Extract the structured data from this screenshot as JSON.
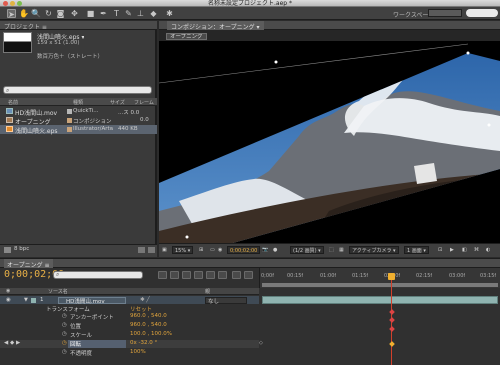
{
  "window": {
    "title": "名称未設定プロジェクト.aep *"
  },
  "toolbar": {
    "workspace_label": "ワークスペース："
  },
  "project_panel": {
    "tab_label": "プロジェクト ≡",
    "selected_item": {
      "name": "浅間山噴火.eps ▾",
      "dimensions": "159 x 51 (1.00)",
      "info": "数百万色＋（ストレート）"
    },
    "search_placeholder": "",
    "columns": [
      "名前",
      "種類",
      "サイズ",
      "フレーム"
    ],
    "items": [
      {
        "name": "HD浅間山.mov",
        "type": "QuickTi...",
        "size": "...ス 0.0"
      },
      {
        "name": "オープニング",
        "type": "コンポジション",
        "size": "0.0"
      },
      {
        "name": "浅間山噴火.eps",
        "type": "Illustrator/Artwork",
        "size": "440 KB"
      }
    ],
    "footer_bpc": "8 bpc"
  },
  "comp_panel": {
    "tab_label": "コンポジション：オープニング ▾",
    "subtab": "オープニング",
    "zoom": "15% ▾",
    "timecode": "0;00;02;00",
    "resolution": "(1/2 画質) ▾",
    "camera": "アクティブカメラ ▾",
    "views": "1 画面 ▾",
    "colors": {
      "viewer_bg": "#000000",
      "sky": "#2f6fb3"
    }
  },
  "timeline": {
    "tab_label": "オープニング ≡",
    "timecode": "0;00;02;00",
    "search_placeholder": "",
    "ruler_ticks": [
      "0;00f",
      "00:15f",
      "01:00f",
      "01:15f",
      "02:00f",
      "02:15f",
      "03:00f",
      "03:15f"
    ],
    "col_source": "ソース名",
    "col_parent": "親",
    "layer": {
      "index": "1",
      "name": "HD浅間山.mov",
      "parent": "なし"
    },
    "properties": [
      {
        "name": "トランスフォーム",
        "value": "リセット"
      },
      {
        "name": "アンカーポイント",
        "value": "960.0 , 540.0"
      },
      {
        "name": "位置",
        "value": "960.0 , 540.0"
      },
      {
        "name": "スケール",
        "value": "100.0 , 100.0%"
      },
      {
        "name": "回転",
        "value": "0x -32.0 °"
      },
      {
        "name": "不透明度",
        "value": "100%"
      }
    ],
    "colors": {
      "playhead": "#d2402b",
      "value": "#e2a53d",
      "timecode": "#e8b046"
    }
  }
}
